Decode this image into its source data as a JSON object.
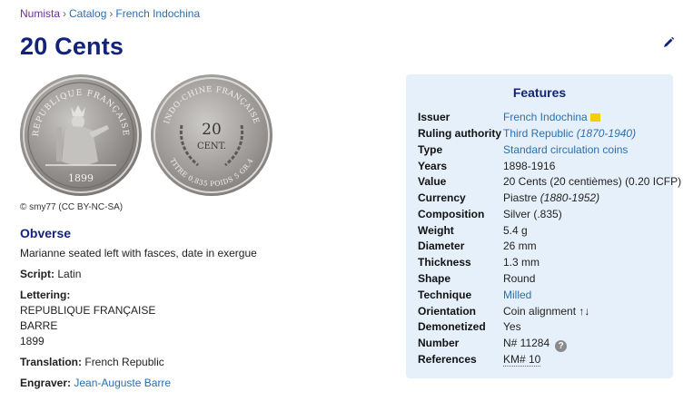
{
  "breadcrumb": {
    "items": [
      "Numista",
      "Catalog",
      "French Indochina"
    ],
    "separator": "›"
  },
  "title": "20 Cents",
  "images": {
    "copyright": "© smy77 (CC BY-NC-SA)",
    "obverse_legend": "REPUBLIQUE FRANÇAISE",
    "obverse_date": "1899",
    "reverse_legend_top": "INDO-CHINE FRANÇAISE",
    "reverse_value_1": "20",
    "reverse_value_2": "CENT.",
    "reverse_legend_bottom": "TITRE 0,835 POIDS 5 GR.4"
  },
  "obverse": {
    "heading": "Obverse",
    "description": "Marianne seated left with fasces, date in exergue",
    "script_label": "Script:",
    "script_value": "Latin",
    "lettering_label": "Lettering:",
    "lettering_lines": [
      "REPUBLIQUE FRANÇAISE",
      "BARRE",
      "1899"
    ],
    "translation_label": "Translation:",
    "translation_value": "French Republic",
    "engraver_label": "Engraver:",
    "engraver_value": "Jean-Auguste Barre"
  },
  "features": {
    "title": "Features",
    "issuer_label": "Issuer",
    "issuer_value": "French Indochina",
    "ruling_label": "Ruling authority",
    "ruling_value": "Third Republic",
    "ruling_years": "(1870-1940)",
    "type_label": "Type",
    "type_value": "Standard circulation coins",
    "years_label": "Years",
    "years_value": "1898-1916",
    "value_label": "Value",
    "value_value": "20 Cents (20 centièmes) (0.20 ICFP)",
    "currency_label": "Currency",
    "currency_value": "Piastre",
    "currency_years": "(1880-1952)",
    "composition_label": "Composition",
    "composition_value": "Silver (.835)",
    "weight_label": "Weight",
    "weight_value": "5.4 g",
    "diameter_label": "Diameter",
    "diameter_value": "26 mm",
    "thickness_label": "Thickness",
    "thickness_value": "1.3 mm",
    "shape_label": "Shape",
    "shape_value": "Round",
    "technique_label": "Technique",
    "technique_value": "Milled",
    "orientation_label": "Orientation",
    "orientation_value": "Coin alignment ↑↓",
    "demonetized_label": "Demonetized",
    "demonetized_value": "Yes",
    "number_label": "Number",
    "number_value": "N# 11284",
    "references_label": "References",
    "references_value": "KM# 10"
  },
  "icons": [
    "edit-pencil-icon",
    "flag-icon",
    "help-question-icon"
  ],
  "colors": {
    "title": "#13237a",
    "link": "#2a6fb0",
    "features_bg": "#e6f0fa"
  }
}
